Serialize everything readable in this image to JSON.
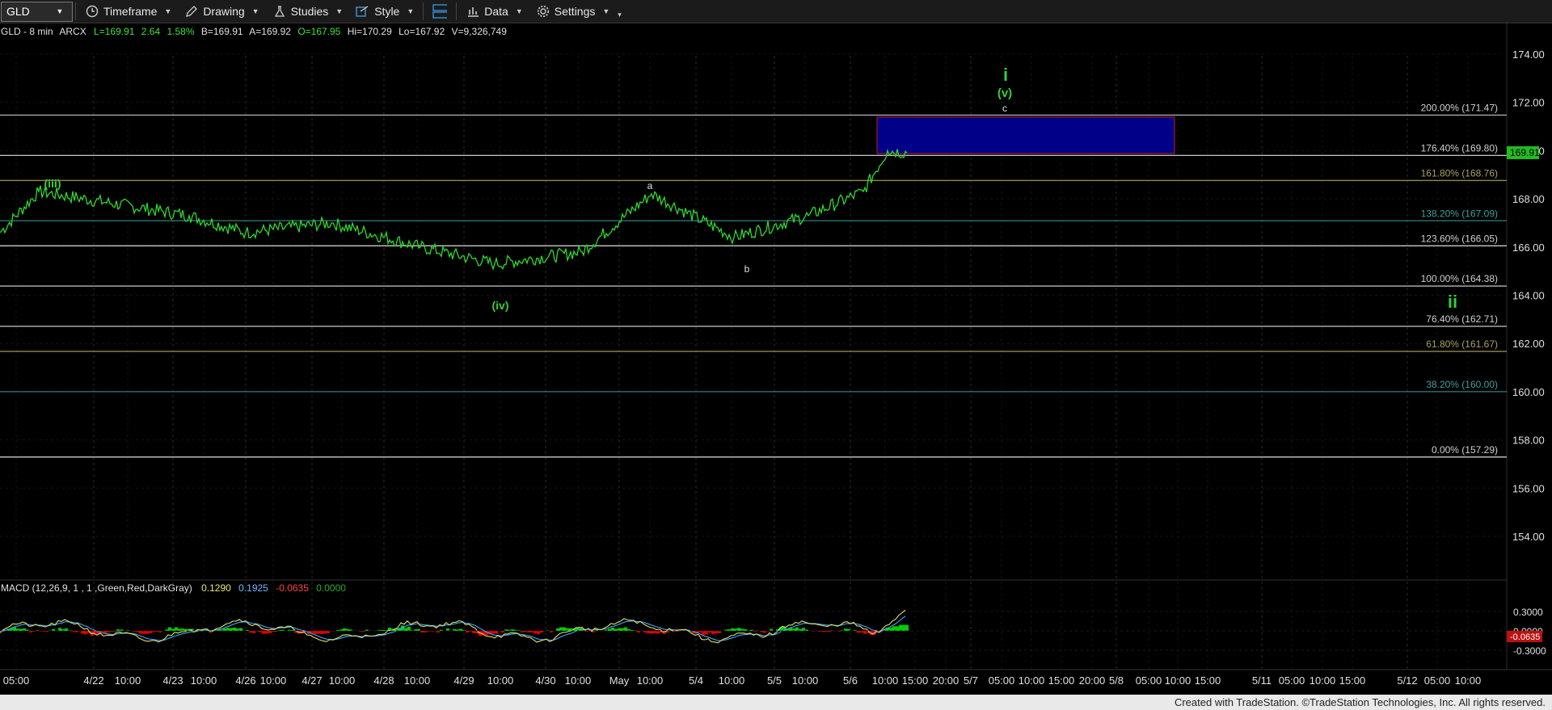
{
  "toolbar": {
    "symbol": "GLD",
    "timeframe_label": "Timeframe",
    "drawing_label": "Drawing",
    "studies_label": "Studies",
    "style_label": "Style",
    "data_label": "Data",
    "settings_label": "Settings"
  },
  "header": {
    "symbol": "GLD - 8 min",
    "exchange": "ARCX",
    "last": "L=169.91",
    "change": "2.64",
    "change_pct": "1.58%",
    "bid": "B=169.91",
    "ask": "A=169.92",
    "open": "O=167.95",
    "high": "Hi=170.29",
    "low": "Lo=167.92",
    "volume": "V=9,326,749"
  },
  "price_axis": {
    "ticks": [
      "174.00",
      "172.00",
      "170.00",
      "168.00",
      "166.00",
      "164.00",
      "162.00",
      "160.00",
      "158.00",
      "156.00",
      "154.00"
    ],
    "last_price_tag": "169.91",
    "last_price": 169.91
  },
  "time_axis": {
    "labels": [
      "05:00",
      "4/22",
      "10:00",
      "4/23",
      "10:00",
      "4/26",
      "10:00",
      "4/27",
      "10:00",
      "4/28",
      "10:00",
      "4/29",
      "10:00",
      "4/30",
      "10:00",
      "May",
      "10:00",
      "5/4",
      "10:00",
      "5/5",
      "10:00",
      "5/6",
      "10:00",
      "15:00",
      "20:00",
      "5/7",
      "05:00",
      "10:00",
      "15:00",
      "20:00",
      "5/8",
      "05:00",
      "10:00",
      "15:00",
      "5/11",
      "05:00",
      "10:00",
      "15:00",
      "5/12",
      "05:00",
      "10:00"
    ]
  },
  "fib_levels": [
    {
      "label": "200.00% (171.47)",
      "price": 171.47,
      "color": "#b8b8b8"
    },
    {
      "label": "176.40% (169.80)",
      "price": 169.8,
      "color": "#c8c8c8"
    },
    {
      "label": "161.80% (168.76)",
      "price": 168.76,
      "color": "#8f8b4a"
    },
    {
      "label": "138.20% (167.09)",
      "price": 167.09,
      "color": "#2f7f7f"
    },
    {
      "label": "123.60% (166.05)",
      "price": 166.05,
      "color": "#c8c8c8"
    },
    {
      "label": "100.00% (164.38)",
      "price": 164.38,
      "color": "#c8c8c8"
    },
    {
      "label": "76.40% (162.71)",
      "price": 162.71,
      "color": "#c8c8c8"
    },
    {
      "label": "61.80% (161.67)",
      "price": 161.67,
      "color": "#8f8b4a"
    },
    {
      "label": "38.20% (160.00)",
      "price": 160.0,
      "color": "#2f7f7f"
    },
    {
      "label": "0.00% (157.29)",
      "price": 157.29,
      "color": "#c8c8c8"
    }
  ],
  "wave_labels": {
    "iii": "(iii)",
    "iv": "(iv)",
    "a": "a",
    "b": "b",
    "c": "c",
    "v": "(v)",
    "i": "i",
    "ii": "ii"
  },
  "macd": {
    "title": "MACD (12,26,9, 1 , 1 ,Green,Red,DarkGray)",
    "v1": "0.1290",
    "v2": "0.1925",
    "v3": "-0.0635",
    "v4": "0.0000",
    "axis": [
      "0.3000",
      "0.0000",
      "-0.3000"
    ],
    "tag": "-0.0635",
    "colors": {
      "macd": "#e0e070",
      "signal": "#40a8ff",
      "hist_up": "#00cc00",
      "hist_down": "#dd0000"
    }
  },
  "chart_data": {
    "type": "line",
    "title": "GLD - 8 min",
    "ylim": [
      152.5,
      175.2
    ],
    "x": [
      "05:00",
      "4/22",
      "4/23",
      "4/26",
      "4/27",
      "4/28",
      "4/29",
      "4/30",
      "May",
      "5/4",
      "5/5",
      "5/6",
      "5/6 10:00",
      "5/6 15:00"
    ],
    "series": [
      {
        "values": [
          166.6,
          168.3,
          167.3,
          166.6,
          167.0,
          166.0,
          165.3,
          165.8,
          168.2,
          166.4,
          167.3,
          168.3,
          170.0,
          169.91
        ]
      }
    ]
  },
  "footer": {
    "text": "Created with TradeStation. ©TradeStation Technologies, Inc. All rights reserved."
  }
}
